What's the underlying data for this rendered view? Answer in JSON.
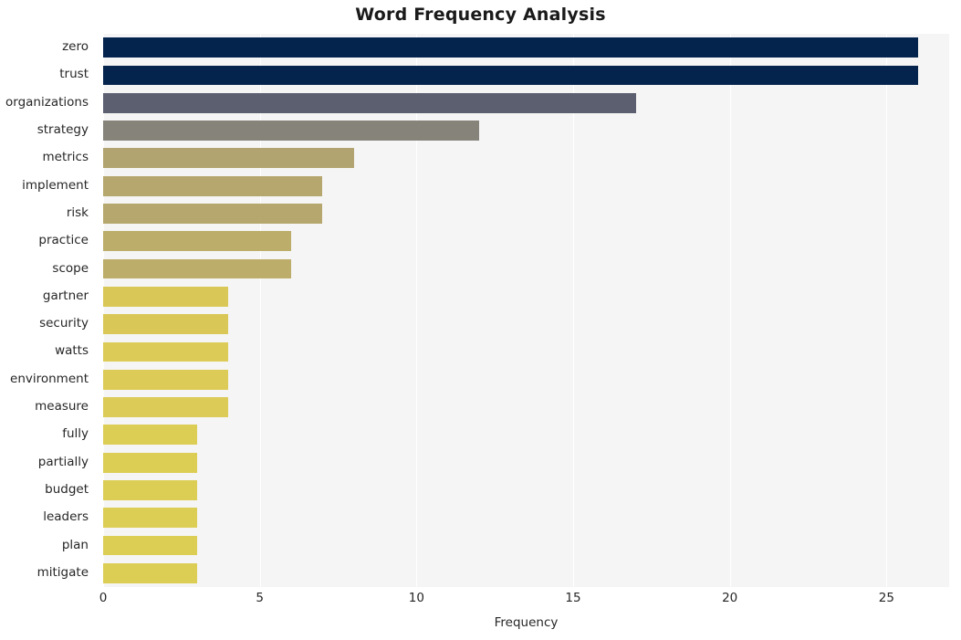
{
  "chart_data": {
    "type": "bar",
    "orientation": "horizontal",
    "title": "Word Frequency Analysis",
    "xlabel": "Frequency",
    "ylabel": "",
    "xlim": [
      0,
      27
    ],
    "ylim": [
      0,
      20
    ],
    "grid": true,
    "legend": false,
    "xticks": [
      0,
      5,
      10,
      15,
      20,
      25
    ],
    "xtick_labels": [
      "0",
      "5",
      "10",
      "15",
      "20",
      "25"
    ],
    "categories": [
      "zero",
      "trust",
      "organizations",
      "strategy",
      "metrics",
      "implement",
      "risk",
      "practice",
      "scope",
      "gartner",
      "security",
      "watts",
      "environment",
      "measure",
      "fully",
      "partially",
      "budget",
      "leaders",
      "plan",
      "mitigate"
    ],
    "values": [
      26,
      26,
      17,
      12,
      8,
      7,
      7,
      6,
      6,
      4,
      4,
      4,
      4,
      4,
      3,
      3,
      3,
      3,
      3,
      3
    ],
    "bar_colors": [
      "#04244d",
      "#04244d",
      "#5b5f70",
      "#85837a",
      "#b2a470",
      "#b5a76d",
      "#b5a76d",
      "#bcad6a",
      "#bcad6a",
      "#d9c857",
      "#d9c857",
      "#dccb56",
      "#dccb56",
      "#dccb56",
      "#dccd55",
      "#dccd55",
      "#dccd55",
      "#dccd55",
      "#dccd55",
      "#dccd55"
    ]
  },
  "style": {
    "plot_background": "#f5f5f5",
    "figure_background": "#ffffff",
    "gridline_color": "#ffffff",
    "text_color": "#262626",
    "title_color": "#1a1a1a"
  }
}
